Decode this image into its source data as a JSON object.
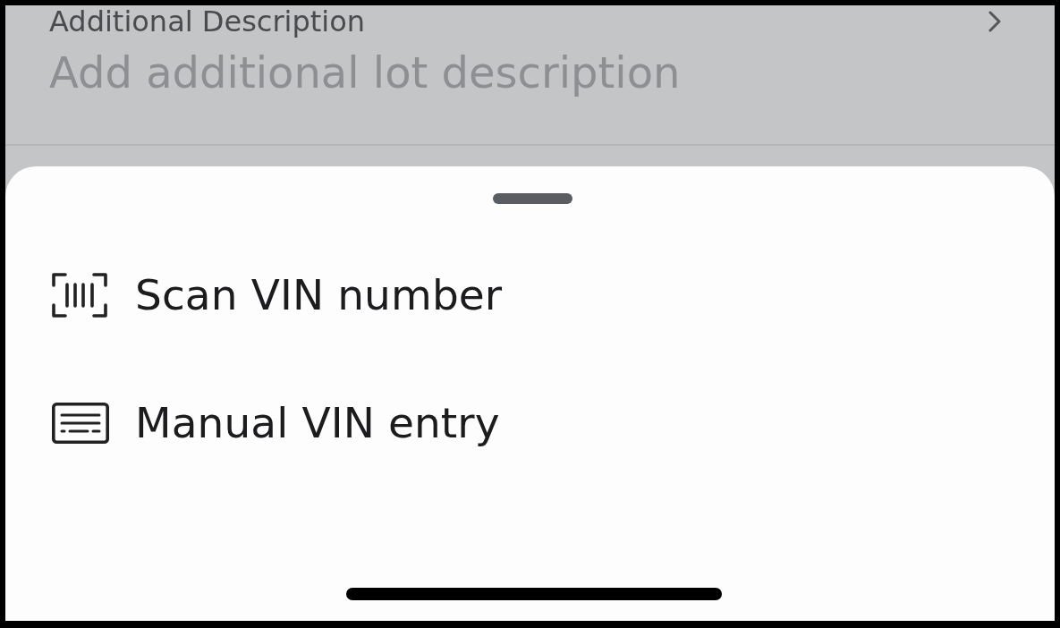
{
  "field": {
    "label": "Additional Description",
    "placeholder": "Add additional lot description"
  },
  "sheet": {
    "options": [
      {
        "kind": "scan",
        "label": "Scan VIN number"
      },
      {
        "kind": "manual",
        "label": "Manual VIN entry"
      }
    ]
  }
}
